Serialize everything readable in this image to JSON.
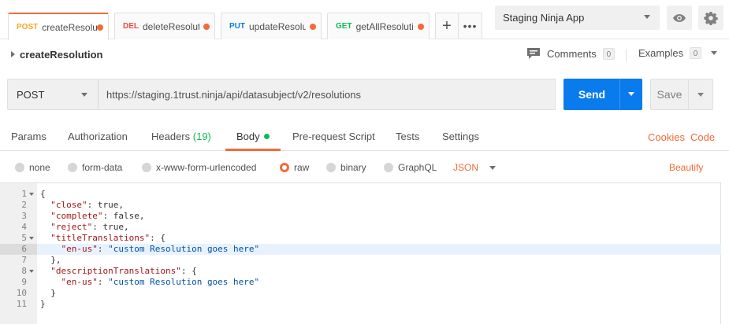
{
  "tabs": [
    {
      "method": "POST",
      "title": "createResolu",
      "active": true
    },
    {
      "method": "DEL",
      "title": "deleteResoluti",
      "active": false
    },
    {
      "method": "PUT",
      "title": "updateResolu",
      "active": false
    },
    {
      "method": "GET",
      "title": "getAllResoluti",
      "active": false
    }
  ],
  "tab_actions": {
    "add": "+",
    "more": "•••"
  },
  "environment": {
    "selected": "Staging Ninja App"
  },
  "request": {
    "name": "createResolution",
    "method": "POST",
    "url": "https://staging.1trust.ninja/api/datasubject/v2/resolutions"
  },
  "comments": {
    "label": "Comments",
    "count": "0"
  },
  "examples": {
    "label": "Examples",
    "count": "0"
  },
  "buttons": {
    "send": "Send",
    "save": "Save"
  },
  "request_tabs": {
    "params": "Params",
    "authorization": "Authorization",
    "headers": "Headers",
    "headers_count": "(19)",
    "body": "Body",
    "pre_request": "Pre-request Script",
    "tests": "Tests",
    "settings": "Settings",
    "cookies": "Cookies",
    "code": "Code"
  },
  "body_types": {
    "none": "none",
    "form_data": "form-data",
    "urlencoded": "x-www-form-urlencoded",
    "raw": "raw",
    "binary": "binary",
    "graphql": "GraphQL",
    "selected": "raw",
    "format": "JSON",
    "beautify": "Beautify"
  },
  "editor": {
    "highlighted_line": 6,
    "lines": [
      {
        "n": "1",
        "text": "{"
      },
      {
        "n": "2",
        "text": "  \"close\": true,"
      },
      {
        "n": "3",
        "text": "  \"complete\": false,"
      },
      {
        "n": "4",
        "text": "  \"reject\": true,"
      },
      {
        "n": "5",
        "text": "  \"titleTranslations\": {"
      },
      {
        "n": "6",
        "text": "    \"en-us\": \"custom Resolution goes here\""
      },
      {
        "n": "7",
        "text": "  },"
      },
      {
        "n": "8",
        "text": "  \"descriptionTranslations\": {"
      },
      {
        "n": "9",
        "text": "    \"en-us\": \"custom Resolution goes here\""
      },
      {
        "n": "10",
        "text": "  }"
      },
      {
        "n": "11",
        "text": "}"
      }
    ]
  },
  "colors": {
    "accent": "#f26b3a",
    "send_blue": "#097bed",
    "post": "#f5a623",
    "delete": "#ed4b48",
    "put": "#097bed",
    "get": "#0cbb52",
    "json_key": "#a31515",
    "json_string": "#0451a5"
  }
}
